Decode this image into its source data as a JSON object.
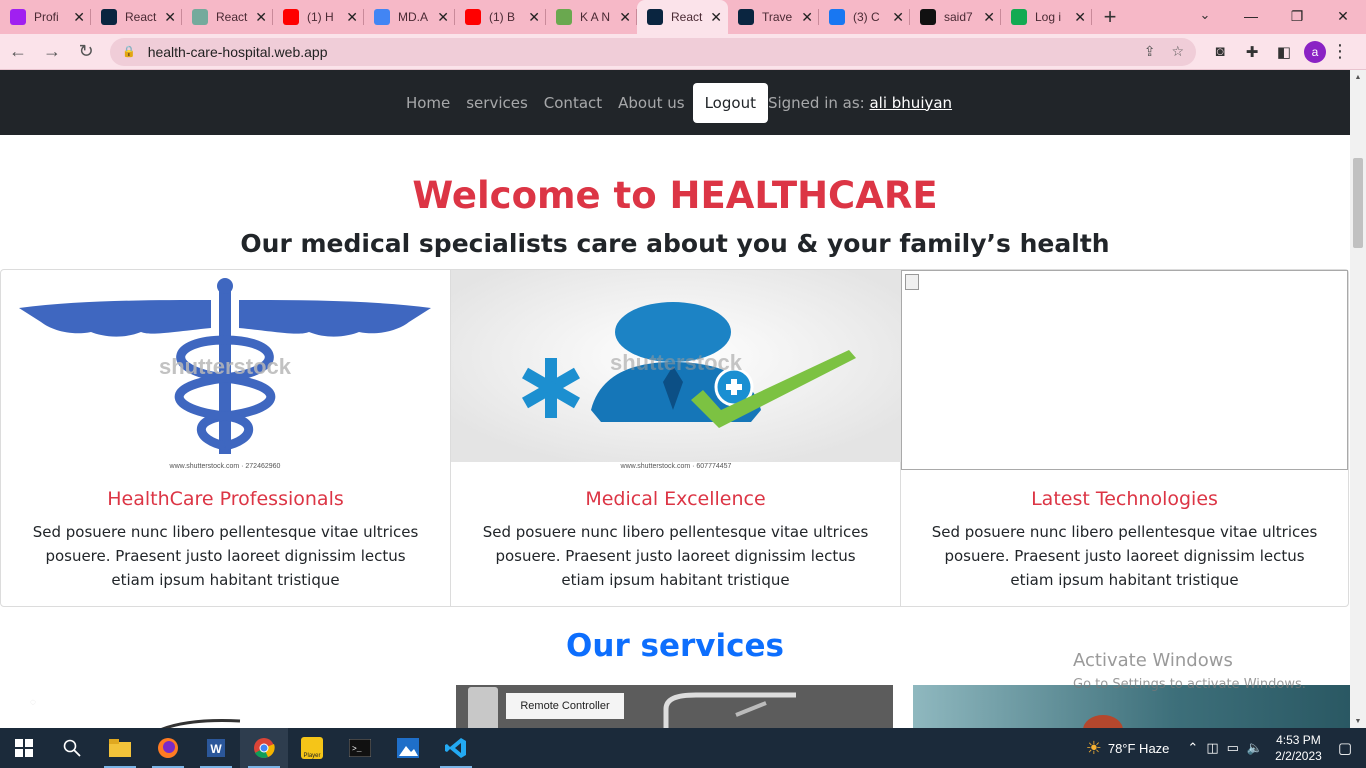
{
  "browser": {
    "tabs": [
      {
        "title": "Profi",
        "icon": "profile-app-icon",
        "color": "#a020f0"
      },
      {
        "title": "React",
        "icon": "react-icon",
        "color": "#0a2540"
      },
      {
        "title": "React",
        "icon": "openai-icon",
        "color": "#74aa9c"
      },
      {
        "title": "(1) H",
        "icon": "youtube-icon",
        "color": "#ff0000"
      },
      {
        "title": "MD.A",
        "icon": "docs-icon",
        "color": "#4285f4"
      },
      {
        "title": "(1) B",
        "icon": "youtube-icon",
        "color": "#ff0000"
      },
      {
        "title": "K A N",
        "icon": "avatar-icon",
        "color": "#6aa84f"
      },
      {
        "title": "React",
        "icon": "react-icon",
        "color": "#0a2540",
        "active": true
      },
      {
        "title": "Trave",
        "icon": "react-icon",
        "color": "#0a2540"
      },
      {
        "title": "(3) C",
        "icon": "facebook-icon",
        "color": "#1877f2"
      },
      {
        "title": "said7",
        "icon": "github-icon",
        "color": "#111111"
      },
      {
        "title": "Log i",
        "icon": "leaf-icon",
        "color": "#13aa52"
      }
    ],
    "new_tab": "+",
    "url": "health-care-hospital.web.app",
    "profile_initial": "a"
  },
  "site": {
    "nav": {
      "home": "Home",
      "services": "services",
      "contact": "Contact",
      "about": "About us",
      "logout": "Logout",
      "signed_in_label": "Signed in as:",
      "user_name": "ali bhuiyan"
    },
    "welcome": "Welcome to HEALTHCARE",
    "subtitle": "Our medical specialists care about you & your family’s health",
    "features": [
      {
        "title": "HealthCare Professionals",
        "text": "Sed posuere nunc libero pellentesque vitae ultrices posuere. Praesent justo laoreet dignissim lectus etiam ipsum habitant tristique",
        "watermark": "shutterstock",
        "caption": "www.shutterstock.com · 272462960"
      },
      {
        "title": "Medical Excellence",
        "text": "Sed posuere nunc libero pellentesque vitae ultrices posuere. Praesent justo laoreet dignissim lectus etiam ipsum habitant tristique",
        "watermark": "shutterstock",
        "caption": "www.shutterstock.com · 607774457"
      },
      {
        "title": "Latest Technologies",
        "text": "Sed posuere nunc libero pellentesque vitae ultrices posuere. Praesent justo laoreet dignissim lectus etiam ipsum habitant tristique"
      }
    ],
    "services_title": "Our services",
    "service_image_label": "Remote Controller"
  },
  "watermark": {
    "line1": "Activate Windows",
    "line2": "Go to Settings to activate Windows."
  },
  "taskbar": {
    "weather": "78°F  Haze",
    "time": "4:53 PM",
    "date": "2/2/2023",
    "player_label": "Player"
  },
  "colors": {
    "tabstrip": "#f6b8c7",
    "navbar": "#212529",
    "accent_red": "#dc3545",
    "accent_blue": "#0d6efd"
  }
}
